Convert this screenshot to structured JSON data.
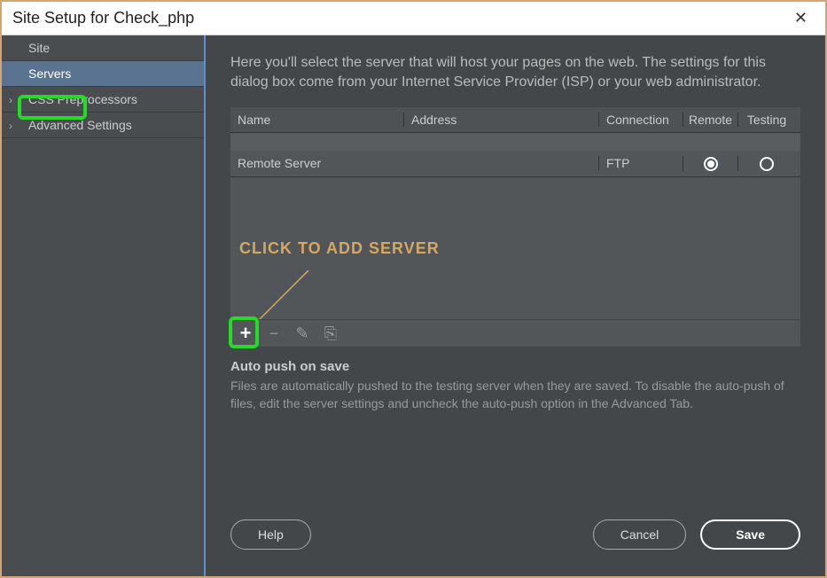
{
  "window_title": "Site Setup for Check_php",
  "sidebar": {
    "items": [
      {
        "label": "Site",
        "has_chevron": false
      },
      {
        "label": "Servers",
        "has_chevron": false,
        "selected": true
      },
      {
        "label": "CSS Preprocessors",
        "has_chevron": true
      },
      {
        "label": "Advanced Settings",
        "has_chevron": true
      }
    ]
  },
  "intro": "Here you'll select the server that will host your pages on the web. The settings for this dialog box come from your Internet Service Provider (ISP) or your web administrator.",
  "table": {
    "headers": {
      "name": "Name",
      "address": "Address",
      "connection": "Connection",
      "remote": "Remote",
      "testing": "Testing"
    },
    "rows": [
      {
        "name": "Remote Server",
        "address": "",
        "connection": "FTP",
        "remote": true,
        "testing": false
      }
    ]
  },
  "annotation": "CLICK TO ADD SERVER",
  "toolbar_icons": {
    "add": "+",
    "remove": "−",
    "edit": "✎",
    "duplicate": "⎘"
  },
  "autopush": {
    "heading": "Auto push on save",
    "desc": "Files are automatically pushed to the testing server when they are saved. To disable the auto-push of files, edit the server settings and uncheck the auto-push option in the Advanced Tab."
  },
  "buttons": {
    "help": "Help",
    "cancel": "Cancel",
    "save": "Save"
  }
}
